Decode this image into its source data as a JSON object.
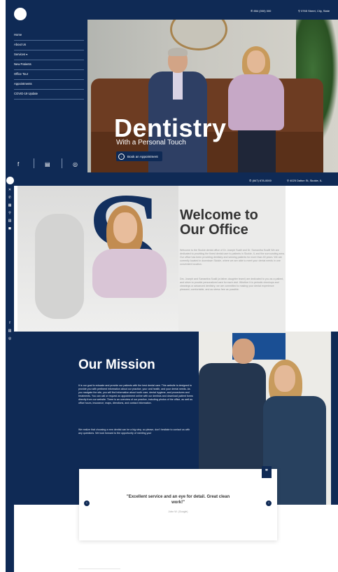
{
  "header": {
    "phone": "854 (000) 000",
    "address": "0765 Street, City, State"
  },
  "sidebar": {
    "items": [
      {
        "label": "Home"
      },
      {
        "label": "About Us"
      },
      {
        "label": "Services  ▾"
      },
      {
        "label": "New Patients"
      },
      {
        "label": "Office Tour"
      },
      {
        "label": "Appointments"
      },
      {
        "label": "COVID-19 Update"
      }
    ],
    "social": [
      "facebook-icon",
      "google-icon",
      "instagram-icon"
    ]
  },
  "hero": {
    "title": "Dentistry",
    "subtitle": "With a Personal Touch",
    "button_label": "Book an Appointment"
  },
  "header2": {
    "phone": "(847) 678-0000",
    "address": "4025 Dalton St, Skokie, IL"
  },
  "welcome": {
    "title": "Welcome to Our Office",
    "para1": "Welcome to the Skokie dental office of Dr. Joseph Scalli and Dr. Samantha Scalli! We are dedicated to providing the finest dental care to patients in Skokie, IL and the surrounding area. Our office has been providing dentistry and winning patients for more than 40 years. We are currently located in downtown Skokie, where we are able to meet your dental needs in one convenient location.",
    "para2": "Drs. Joseph and Samantha Scalli (a father-daughter team!) are dedicated to you as a patient, and strive to provide personalized care for each visit. Whether it is periodic checkups and cleanings or advanced dentistry, we are committed to making your dental experience pleasant, comfortable, and as stress free as possible."
  },
  "mission": {
    "title": "Our Mission",
    "para1": "It is our goal to educate and provide our patients with the best dental care. This website is designed to provide you with pertinent information about our practice, your oral health, and your dental needs. As you navigate the site, you will find information about tooth care, dental hygiene, and procedures and treatments. You can call or request an appointment online with our dentists and download patient forms directly from our website. There is an overview of our practice, including photos of the office, as well as office hours, insurance, maps, directions, and contact information.",
    "para2": "We realize that choosing a new dentist can be a big step, so please, don't hesitate to contact us with any questions. We look forward to the opportunity of meeting you!"
  },
  "testimonial": {
    "quote": "\"Excellent service and an eye for detail. Great clean work!\"",
    "author": "John W. (Google)"
  },
  "colors": {
    "navy": "#0f2a55",
    "white": "#ffffff",
    "heading_dark": "#333333"
  }
}
